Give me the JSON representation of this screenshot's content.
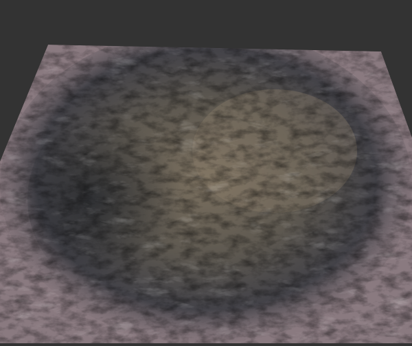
{
  "scene": {
    "subject": "terrain-mesh",
    "colors": {
      "background": "#333333",
      "lowland": "#8a7a80",
      "lowland_light": "#b8aeb2",
      "rock_tan": "#8f826d",
      "rock_dark": "#2f3238",
      "snow": "#d8d4d6"
    }
  }
}
